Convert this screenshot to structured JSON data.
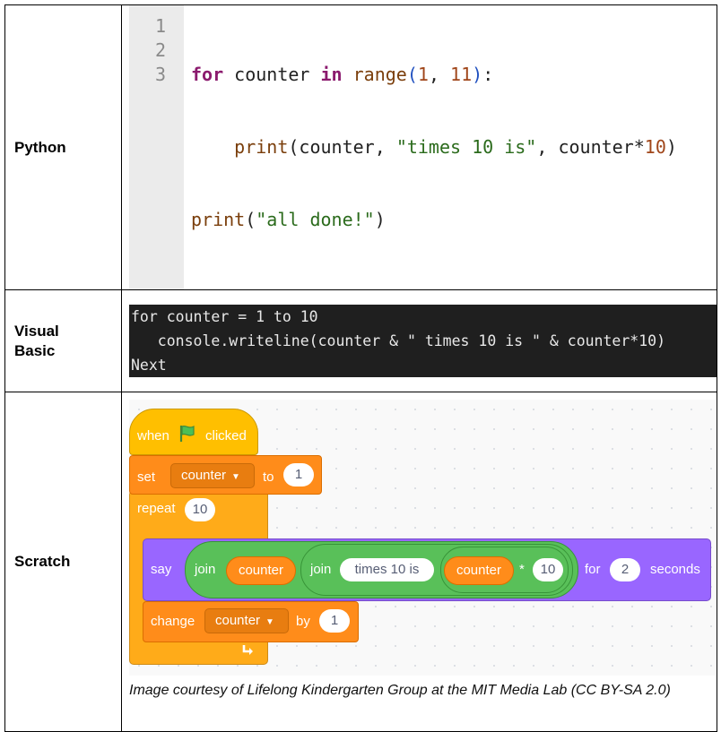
{
  "rows": {
    "python": {
      "label": "Python"
    },
    "vb": {
      "label1": "Visual",
      "label2": "Basic"
    },
    "scratch": {
      "label": "Scratch"
    }
  },
  "python": {
    "line_numbers": [
      "1",
      "2",
      "3"
    ],
    "l1": {
      "kw1": "for",
      "t1": " counter ",
      "kw2": "in",
      "t2": " ",
      "fn": "range",
      "p1": "(",
      "n1": "1",
      "t3": ", ",
      "n2": "11",
      "p2": ")",
      "t4": ":"
    },
    "l2": {
      "indent": "    ",
      "fn": "print",
      "t1": "(counter, ",
      "str": "\"times 10 is\"",
      "t2": ", counter*",
      "n": "10",
      "t3": ")"
    },
    "l3": {
      "fn": "print",
      "t1": "(",
      "str": "\"all done!\"",
      "t2": ")"
    }
  },
  "visual_basic": {
    "lines": [
      "for counter = 1 to 10",
      "   console.writeline(counter & \" times 10 is \" & counter*10)",
      "Next"
    ]
  },
  "scratch": {
    "hat": {
      "when": "when",
      "clicked": "clicked",
      "icon": "green-flag-icon"
    },
    "set": {
      "label": "set",
      "var": "counter",
      "to": "to",
      "value": "1"
    },
    "repeat": {
      "label": "repeat",
      "value": "10",
      "icon": "loop-arrow-icon"
    },
    "say": {
      "label": "say",
      "join1": "join",
      "counter1": "counter",
      "join2": "join",
      "text": "times 10 is",
      "counter2": "counter",
      "op": "*",
      "mul": "10",
      "for": "for",
      "secs": "2",
      "seconds": "seconds"
    },
    "change": {
      "label": "change",
      "var": "counter",
      "by": "by",
      "value": "1"
    },
    "colors": {
      "events": "#FFBF00",
      "variables": "#FF8C1A",
      "control": "#FFAB19",
      "looks": "#9966FF",
      "operators": "#59C059"
    },
    "caption": "Image courtesy of Lifelong Kindergarten Group at the MIT Media Lab (CC BY-SA 2.0)"
  }
}
